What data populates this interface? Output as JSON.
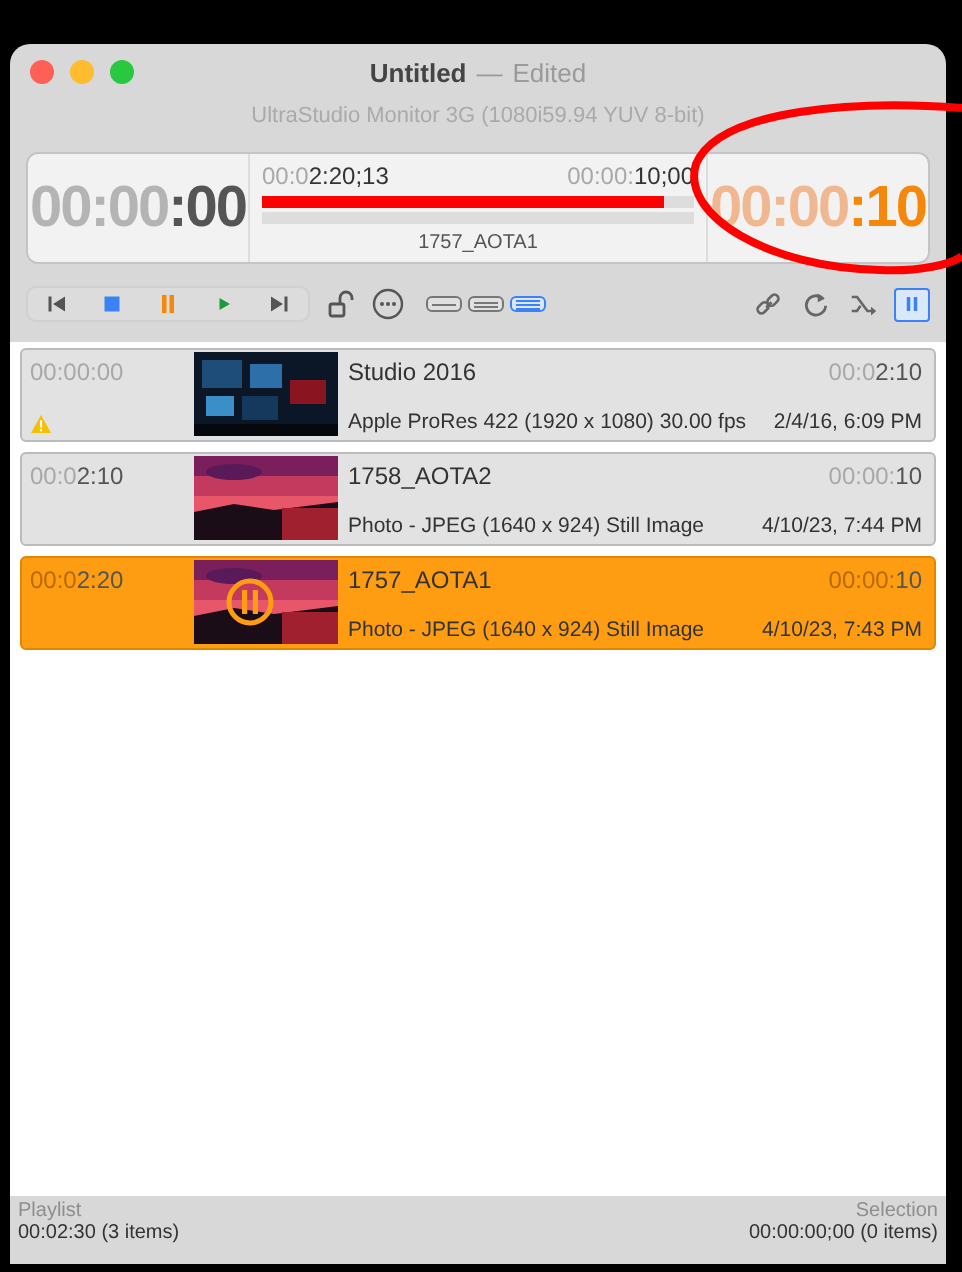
{
  "window": {
    "title": "Untitled",
    "separator": "—",
    "status": "Edited",
    "device": "UltraStudio Monitor 3G (1080i59.94 YUV 8-bit)"
  },
  "timecode": {
    "elapsed": {
      "dim": "00:00",
      "bright": ":00"
    },
    "start": {
      "dim": "00:0",
      "bright": "2:20;13"
    },
    "end": {
      "dim": "00:00:",
      "bright": "10;00"
    },
    "level": 0.93,
    "clip": "1757_AOTA1",
    "remaining": {
      "dim": "00:00",
      "bright": ":10"
    }
  },
  "transport": [
    {
      "kind": "previous"
    },
    {
      "kind": "stop"
    },
    {
      "kind": "pause"
    },
    {
      "kind": "play"
    },
    {
      "kind": "next"
    }
  ],
  "tools": [
    {
      "kind": "lock"
    },
    {
      "kind": "more"
    }
  ],
  "views": [
    {
      "kind": "single",
      "selected": false
    },
    {
      "kind": "double",
      "selected": false
    },
    {
      "kind": "list",
      "selected": true
    }
  ],
  "options": [
    {
      "kind": "link",
      "on": false
    },
    {
      "kind": "repeat",
      "on": false
    },
    {
      "kind": "shuffle",
      "on": false
    },
    {
      "kind": "pause",
      "on": true
    }
  ],
  "playlist": [
    {
      "start": {
        "dim": "00:00:00"
      },
      "name": "Studio 2016",
      "duration": {
        "dim": "00:0",
        "bright": "2:10"
      },
      "format": "Apple ProRes 422 (1920 x 1080) 30.00 fps",
      "date": "2/4/16, 6:09 PM",
      "warning": true,
      "selected": false,
      "playing": false
    },
    {
      "start": {
        "dim": "00:0",
        "bright": "2:10"
      },
      "name": "1758_AOTA2",
      "duration": {
        "dim": "00:00:",
        "bright": "10"
      },
      "format": "Photo - JPEG (1640 x 924) Still Image",
      "date": "4/10/23, 7:44 PM",
      "warning": false,
      "selected": false,
      "playing": false
    },
    {
      "start": {
        "dim": "00:0",
        "bright": "2:20"
      },
      "name": "1757_AOTA1",
      "duration": {
        "dim": "00:00:",
        "bright": "10"
      },
      "format": "Photo - JPEG (1640 x 924) Still Image",
      "date": "4/10/23, 7:43 PM",
      "warning": false,
      "selected": true,
      "playing": true
    }
  ],
  "footer": {
    "left_label": "Playlist",
    "left_value": "00:02:30 (3 items)",
    "right_label": "Selection",
    "right_value": "00:00:00;00 (0 items)"
  }
}
